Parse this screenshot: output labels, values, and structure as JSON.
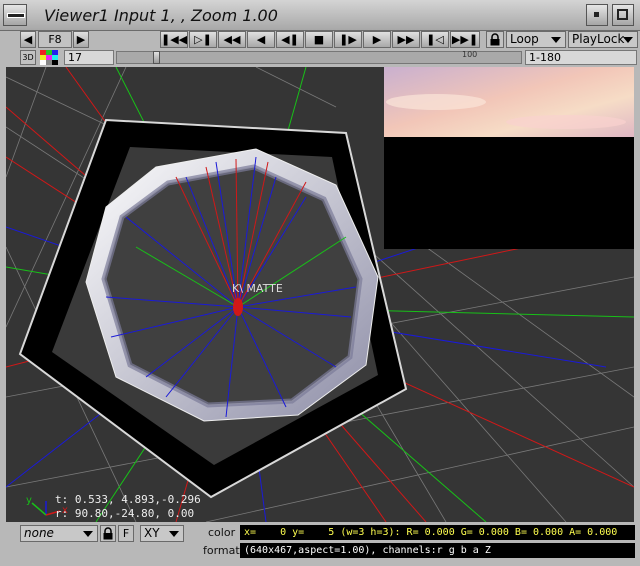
{
  "window": {
    "title": "Viewer1 Input 1, , Zoom 1.00"
  },
  "toolbar": {
    "view_button": "F8",
    "transport": [
      "first-frame-icon",
      "prev-keyframe-icon",
      "fast-backward-icon",
      "step-back-icon",
      "prev-frame-icon",
      "stop-icon",
      "next-frame-icon",
      "play-icon",
      "fast-forward-icon",
      "next-keyframe-icon",
      "last-frame-icon"
    ],
    "loop_mode": "Loop",
    "play_lock": "PlayLock"
  },
  "timeline": {
    "badge_3d": "3D",
    "current_frame": "17",
    "tick_label": "100",
    "range": "1-180",
    "position": 0.09
  },
  "viewport": {
    "matte_label": "K\\ MATTE",
    "axis_labels": [
      "x",
      "y",
      "z"
    ],
    "coords_t": "t: 0.533, 4.893,-0.296",
    "coords_r": "r: 90.80,-24.80, 0.00"
  },
  "bottom": {
    "channel_select": "none",
    "f_button": "F",
    "plane_select": "XY",
    "color_label": "color",
    "color_info": "x=    0 y=    5 (w=3 h=3): R= 0.000 G= 0.000 B= 0.000 A= 0.000",
    "format_label": "format",
    "format_info": "(640x467,aspect=1.00), channels:r g b a Z"
  },
  "colors": {
    "viewport_bg": "#353535",
    "info_text": "#ffff50",
    "ray_red": "#d01818",
    "ray_blue": "#1a1ad8",
    "ray_green": "#18c018"
  }
}
